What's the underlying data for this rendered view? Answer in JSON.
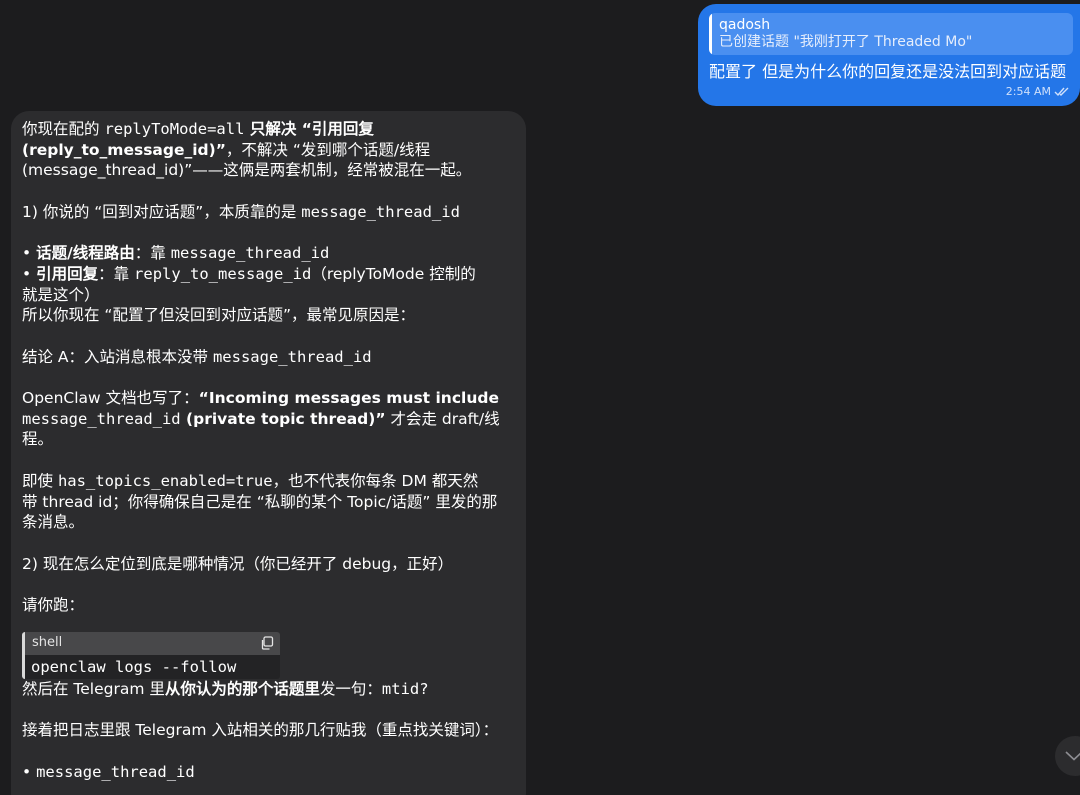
{
  "outgoing": {
    "reply_name": "qadosh",
    "reply_text": "已创建话题 \"我刚打开了 Threaded Mo\"",
    "text": "配置了 但是为什么你的回复还是没法回到对应话题",
    "time": "2:54 AM"
  },
  "incoming": {
    "l1a": "你现在配的 ",
    "l1b": "replyToMode=all",
    "l1c": " 只解决 “引用回复",
    "l2a": "(reply_to_message_id)”",
    "l2b": "，不解决 “发到哪个话题/线程",
    "l3": "(message_thread_id)”——这俩是两套机制，经常被混在一起。",
    "s1a": "1) 你说的 “回到对应话题”，本质靠的是 ",
    "s1b": "message_thread_id",
    "b1a": "• ",
    "b1b": "话题/线程路由",
    "b1c": "：靠 ",
    "b1d": "message_thread_id",
    "b2a": "• ",
    "b2b": "引用回复",
    "b2c": "：靠 ",
    "b2d": "reply_to_message_id",
    "b2e": "（replyToMode 控制的",
    "b2f": "就是这个）",
    "so": "所以你现在 “配置了但没回到对应话题”，最常见原因是：",
    "ca": "结论 A：入站消息根本没带 ",
    "cb": "message_thread_id",
    "oc1a": "OpenClaw 文档也写了：",
    "oc1b": "“Incoming messages must include",
    "oc2a": "message_thread_id",
    "oc2b": " (private topic thread)”",
    "oc2c": " 才会走 draft/线",
    "oc3": "程。",
    "ev1a": "即使 ",
    "ev1b": "has_topics_enabled=true",
    "ev1c": "，也不代表你每条 DM 都天然",
    "ev2": "带 thread id；你得确保自己是在 “私聊的某个 Topic/话题” 里发的那",
    "ev3": "条消息。",
    "s2": "2) 现在怎么定位到底是哪种情况（你已经开了 debug，正好）",
    "run": "请你跑：",
    "code_lang": "shell",
    "code": "openclaw logs --follow",
    "then_a": "然后在 Telegram 里",
    "then_b": "从你认为的那个话题里",
    "then_c": "发一句：",
    "then_d": "mtid?",
    "next": "接着把日志里跟 Telegram 入站相关的那几行贴我（重点找关键词）：",
    "last_a": "• ",
    "last_b": "message_thread_id"
  }
}
